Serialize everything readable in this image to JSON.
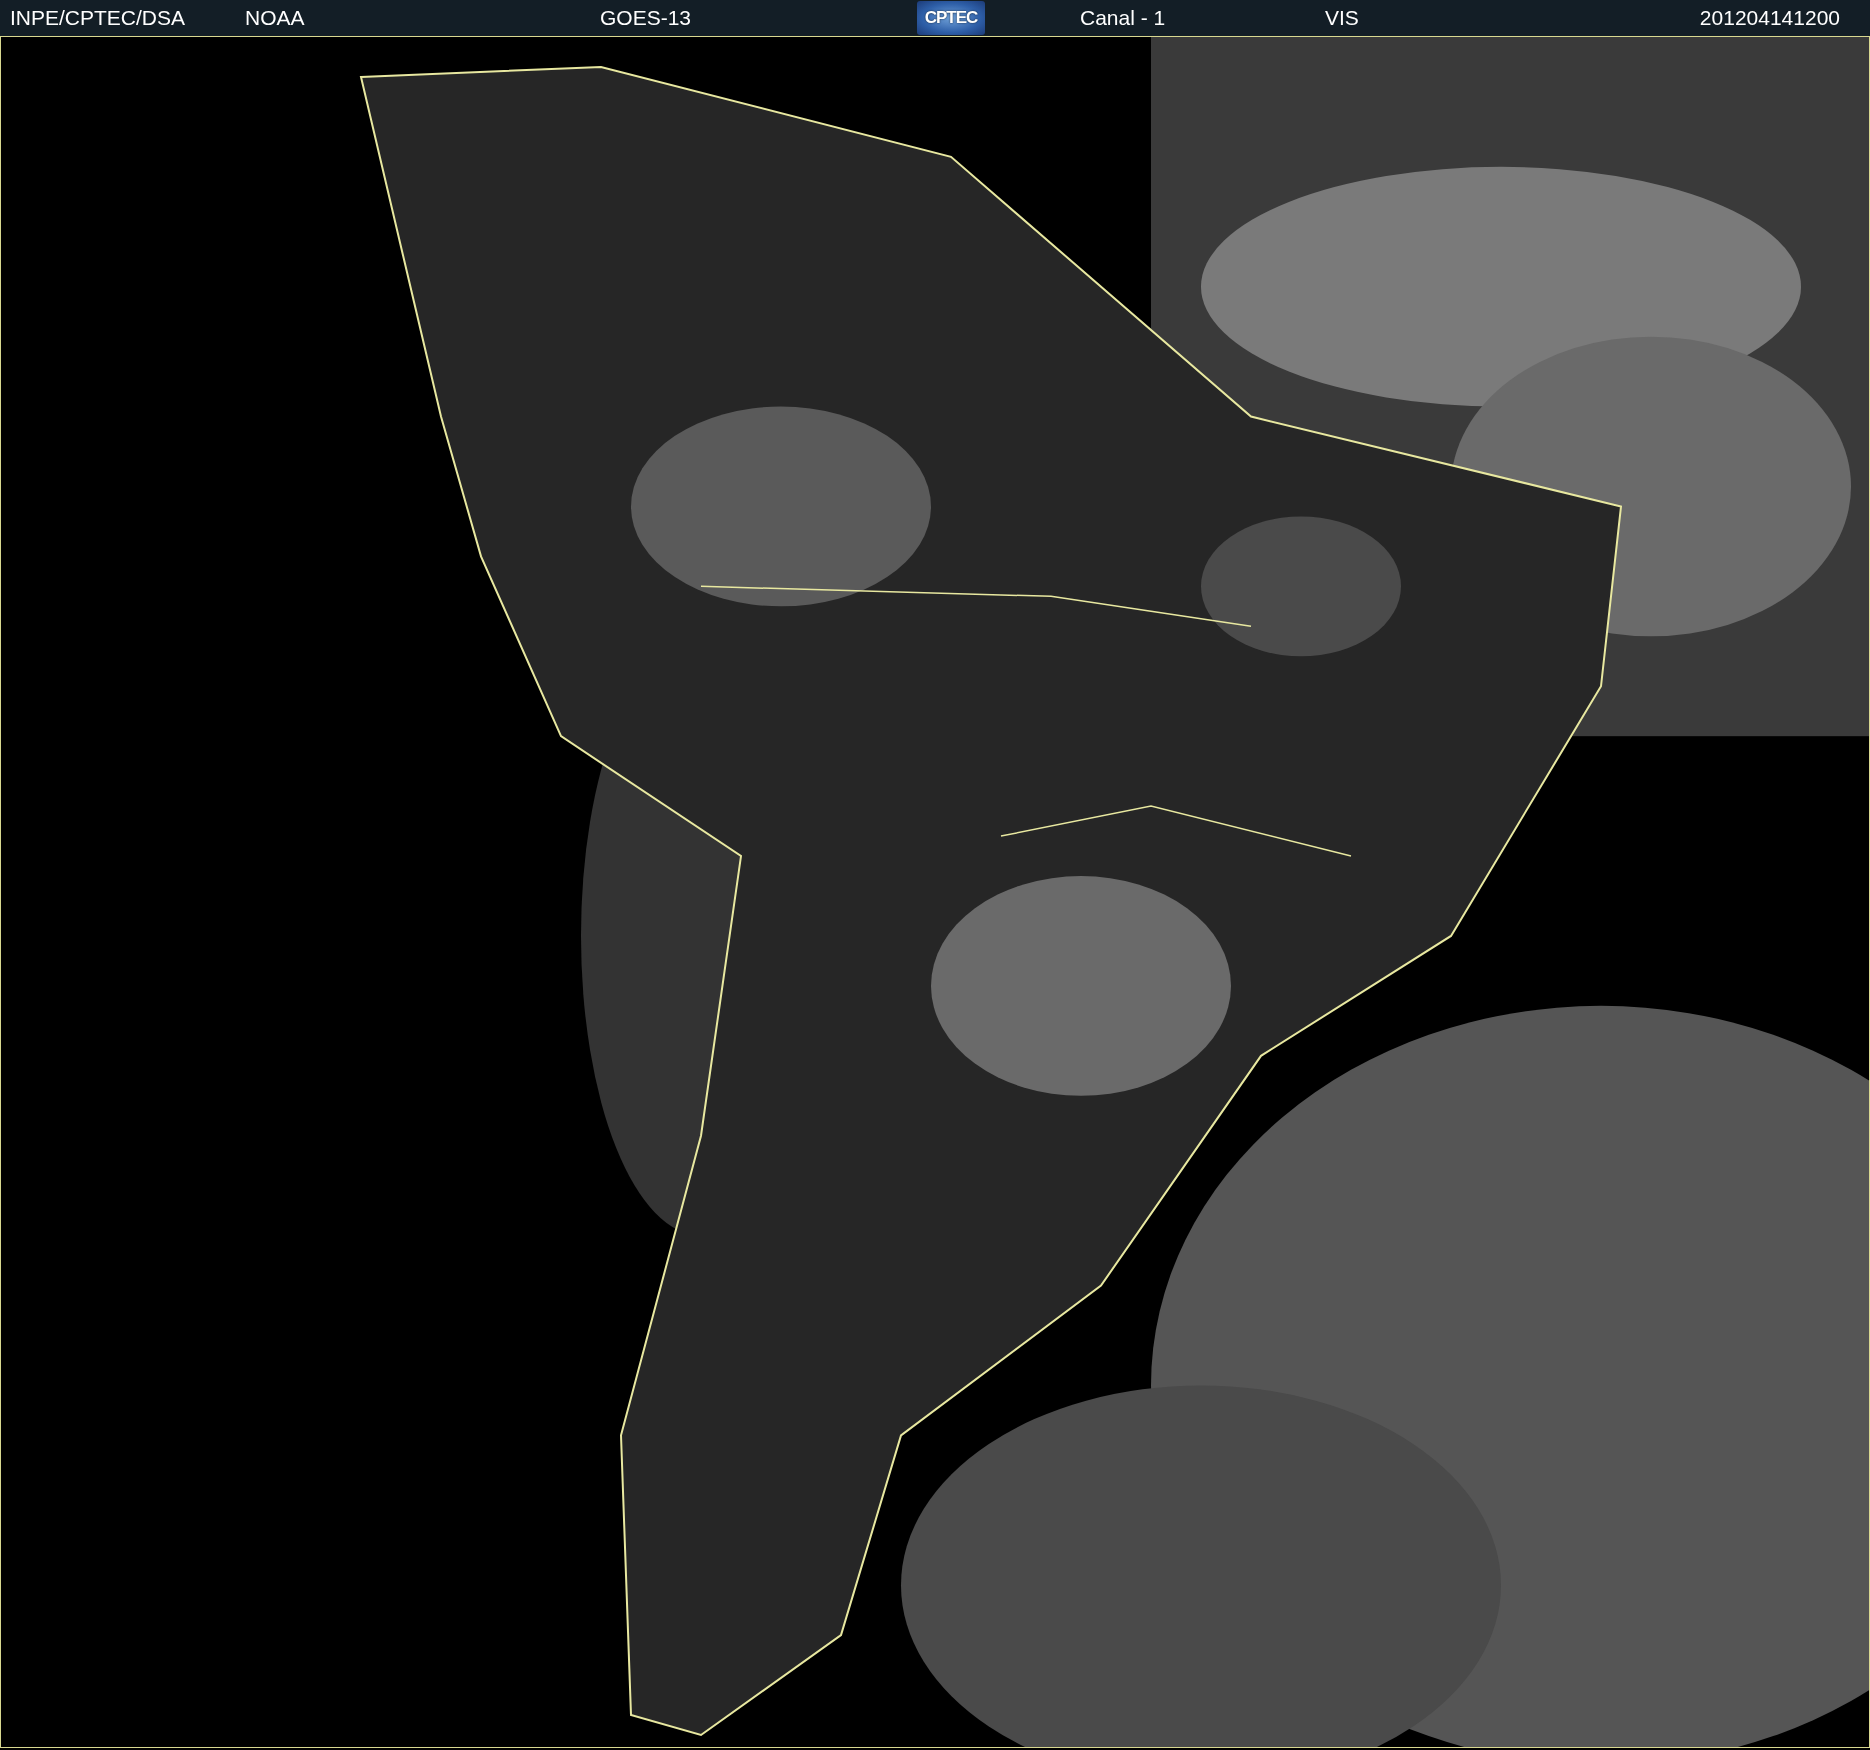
{
  "header": {
    "items": [
      {
        "kind": "text",
        "text": "INPE/CPTEC/DSA"
      },
      {
        "kind": "text",
        "text": "NOAA"
      },
      {
        "kind": "text",
        "text": "GOES-13"
      },
      {
        "kind": "logo",
        "text": "CPTEC"
      },
      {
        "kind": "text",
        "text": "Canal - 1"
      },
      {
        "kind": "text",
        "text": "VIS"
      },
      {
        "kind": "date",
        "text": "201204141200"
      }
    ]
  }
}
